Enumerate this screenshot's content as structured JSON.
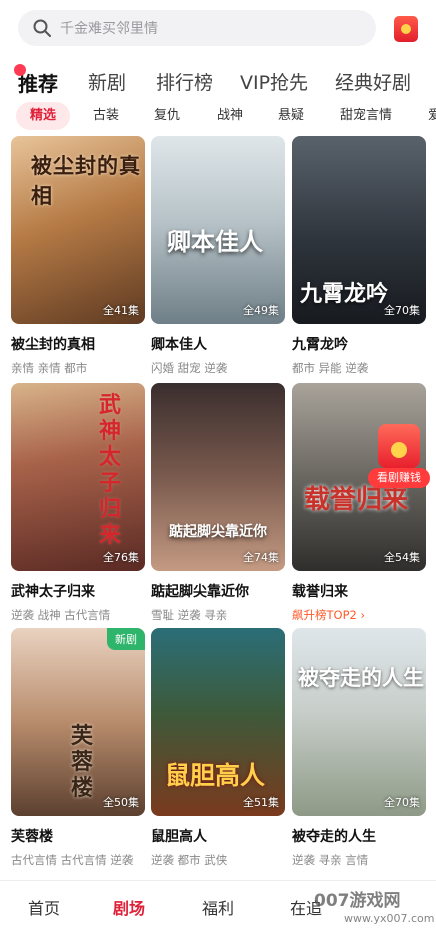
{
  "search": {
    "placeholder": "千金难买邻里情"
  },
  "main_tabs": [
    "推荐",
    "新剧",
    "排行榜",
    "VIP抢先",
    "经典好剧"
  ],
  "chips": [
    "精选",
    "古装",
    "复仇",
    "战神",
    "悬疑",
    "甜宠言情",
    "爱"
  ],
  "cards": [
    {
      "title": "被尘封的真相",
      "tags": "亲情 亲情 都市",
      "episodes": "全41集",
      "poster_text": "被尘封的真相"
    },
    {
      "title": "卿本佳人",
      "tags": "闪婚 甜宠 逆袭",
      "episodes": "全49集",
      "poster_text": "卿本佳人"
    },
    {
      "title": "九霄龙吟",
      "tags": "都市 异能 逆袭",
      "episodes": "全70集",
      "poster_text": "九霄龙吟"
    },
    {
      "title": "武神太子归来",
      "tags": "逆袭 战神 古代言情",
      "episodes": "全76集",
      "poster_text": "武神太子归来"
    },
    {
      "title": "踮起脚尖靠近你",
      "tags": "雪耻 逆袭 寻亲",
      "episodes": "全74集",
      "poster_text": "踮起脚尖靠近你"
    },
    {
      "title": "载誉归来",
      "tags": "飙升榜TOP2 ›",
      "episodes": "全54集",
      "poster_text": "载誉归来"
    },
    {
      "title": "芙蓉楼",
      "tags": "古代言情 古代言情 逆袭",
      "episodes": "全50集",
      "poster_text": "芙蓉楼",
      "badge": "新剧"
    },
    {
      "title": "鼠胆高人",
      "tags": "逆袭 都市 武侠",
      "episodes": "全51集",
      "poster_text": "鼠胆高人"
    },
    {
      "title": "被夺走的人生",
      "tags": "逆袭 寻亲 言情",
      "episodes": "全70集",
      "poster_text": "被夺走的人生"
    }
  ],
  "promo": {
    "label": "看剧赚钱"
  },
  "bottom_nav": [
    "首页",
    "剧场",
    "福利",
    "在追"
  ],
  "watermark": {
    "big": "007游戏网",
    "small": "www.yx007.com"
  },
  "colors": {
    "accent": "#e0213a",
    "search_bg": "#f2f2f4",
    "new_badge": "#2fb56b"
  }
}
